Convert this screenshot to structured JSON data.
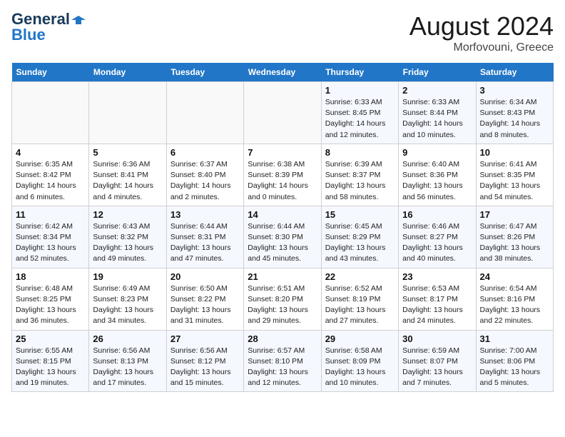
{
  "logo": {
    "line1": "General",
    "line2": "Blue"
  },
  "title": "August 2024",
  "location": "Morfovouni, Greece",
  "days_of_week": [
    "Sunday",
    "Monday",
    "Tuesday",
    "Wednesday",
    "Thursday",
    "Friday",
    "Saturday"
  ],
  "weeks": [
    [
      {
        "day": "",
        "info": ""
      },
      {
        "day": "",
        "info": ""
      },
      {
        "day": "",
        "info": ""
      },
      {
        "day": "",
        "info": ""
      },
      {
        "day": "1",
        "info": "Sunrise: 6:33 AM\nSunset: 8:45 PM\nDaylight: 14 hours\nand 12 minutes."
      },
      {
        "day": "2",
        "info": "Sunrise: 6:33 AM\nSunset: 8:44 PM\nDaylight: 14 hours\nand 10 minutes."
      },
      {
        "day": "3",
        "info": "Sunrise: 6:34 AM\nSunset: 8:43 PM\nDaylight: 14 hours\nand 8 minutes."
      }
    ],
    [
      {
        "day": "4",
        "info": "Sunrise: 6:35 AM\nSunset: 8:42 PM\nDaylight: 14 hours\nand 6 minutes."
      },
      {
        "day": "5",
        "info": "Sunrise: 6:36 AM\nSunset: 8:41 PM\nDaylight: 14 hours\nand 4 minutes."
      },
      {
        "day": "6",
        "info": "Sunrise: 6:37 AM\nSunset: 8:40 PM\nDaylight: 14 hours\nand 2 minutes."
      },
      {
        "day": "7",
        "info": "Sunrise: 6:38 AM\nSunset: 8:39 PM\nDaylight: 14 hours\nand 0 minutes."
      },
      {
        "day": "8",
        "info": "Sunrise: 6:39 AM\nSunset: 8:37 PM\nDaylight: 13 hours\nand 58 minutes."
      },
      {
        "day": "9",
        "info": "Sunrise: 6:40 AM\nSunset: 8:36 PM\nDaylight: 13 hours\nand 56 minutes."
      },
      {
        "day": "10",
        "info": "Sunrise: 6:41 AM\nSunset: 8:35 PM\nDaylight: 13 hours\nand 54 minutes."
      }
    ],
    [
      {
        "day": "11",
        "info": "Sunrise: 6:42 AM\nSunset: 8:34 PM\nDaylight: 13 hours\nand 52 minutes."
      },
      {
        "day": "12",
        "info": "Sunrise: 6:43 AM\nSunset: 8:32 PM\nDaylight: 13 hours\nand 49 minutes."
      },
      {
        "day": "13",
        "info": "Sunrise: 6:44 AM\nSunset: 8:31 PM\nDaylight: 13 hours\nand 47 minutes."
      },
      {
        "day": "14",
        "info": "Sunrise: 6:44 AM\nSunset: 8:30 PM\nDaylight: 13 hours\nand 45 minutes."
      },
      {
        "day": "15",
        "info": "Sunrise: 6:45 AM\nSunset: 8:29 PM\nDaylight: 13 hours\nand 43 minutes."
      },
      {
        "day": "16",
        "info": "Sunrise: 6:46 AM\nSunset: 8:27 PM\nDaylight: 13 hours\nand 40 minutes."
      },
      {
        "day": "17",
        "info": "Sunrise: 6:47 AM\nSunset: 8:26 PM\nDaylight: 13 hours\nand 38 minutes."
      }
    ],
    [
      {
        "day": "18",
        "info": "Sunrise: 6:48 AM\nSunset: 8:25 PM\nDaylight: 13 hours\nand 36 minutes."
      },
      {
        "day": "19",
        "info": "Sunrise: 6:49 AM\nSunset: 8:23 PM\nDaylight: 13 hours\nand 34 minutes."
      },
      {
        "day": "20",
        "info": "Sunrise: 6:50 AM\nSunset: 8:22 PM\nDaylight: 13 hours\nand 31 minutes."
      },
      {
        "day": "21",
        "info": "Sunrise: 6:51 AM\nSunset: 8:20 PM\nDaylight: 13 hours\nand 29 minutes."
      },
      {
        "day": "22",
        "info": "Sunrise: 6:52 AM\nSunset: 8:19 PM\nDaylight: 13 hours\nand 27 minutes."
      },
      {
        "day": "23",
        "info": "Sunrise: 6:53 AM\nSunset: 8:17 PM\nDaylight: 13 hours\nand 24 minutes."
      },
      {
        "day": "24",
        "info": "Sunrise: 6:54 AM\nSunset: 8:16 PM\nDaylight: 13 hours\nand 22 minutes."
      }
    ],
    [
      {
        "day": "25",
        "info": "Sunrise: 6:55 AM\nSunset: 8:15 PM\nDaylight: 13 hours\nand 19 minutes."
      },
      {
        "day": "26",
        "info": "Sunrise: 6:56 AM\nSunset: 8:13 PM\nDaylight: 13 hours\nand 17 minutes."
      },
      {
        "day": "27",
        "info": "Sunrise: 6:56 AM\nSunset: 8:12 PM\nDaylight: 13 hours\nand 15 minutes."
      },
      {
        "day": "28",
        "info": "Sunrise: 6:57 AM\nSunset: 8:10 PM\nDaylight: 13 hours\nand 12 minutes."
      },
      {
        "day": "29",
        "info": "Sunrise: 6:58 AM\nSunset: 8:09 PM\nDaylight: 13 hours\nand 10 minutes."
      },
      {
        "day": "30",
        "info": "Sunrise: 6:59 AM\nSunset: 8:07 PM\nDaylight: 13 hours\nand 7 minutes."
      },
      {
        "day": "31",
        "info": "Sunrise: 7:00 AM\nSunset: 8:06 PM\nDaylight: 13 hours\nand 5 minutes."
      }
    ]
  ]
}
